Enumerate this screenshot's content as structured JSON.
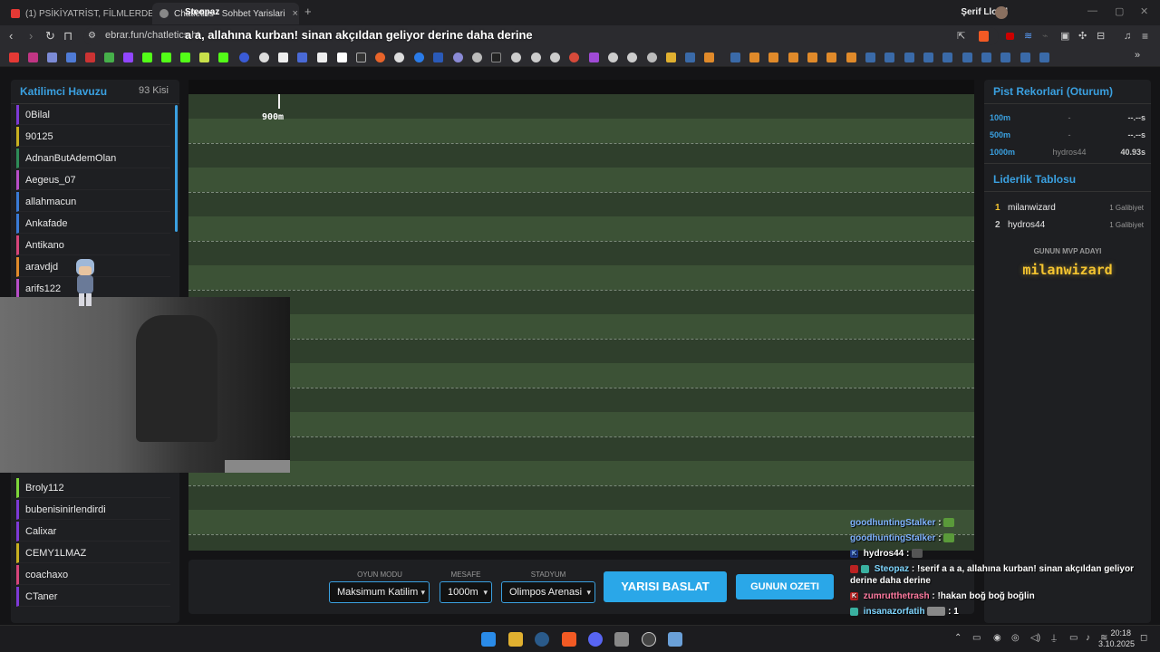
{
  "browser": {
    "tabs": [
      {
        "label": "(1) PSİKİYATRİST, FİLMLERDEKİ SERİ K",
        "favicon_color": "#e53935",
        "close": "×"
      },
      {
        "label": "Chatletics - Sohbet Yarislari",
        "favicon_color": "#aaaaaa",
        "close": "×"
      }
    ],
    "new_tab": "+",
    "profile_name": "Şerif Lloyd",
    "url": "ebrar.fun/chatletics.ht",
    "window_controls": [
      "—",
      "▢",
      "✕"
    ]
  },
  "stream_overlay": {
    "tab_text": "Steopaz",
    "title": "a a, allahına kurban! sinan akçıldan geliyor derine daha derine"
  },
  "participants": {
    "title": "Katilimci Havuzu",
    "count": "93 Kisi",
    "items": [
      {
        "name": "0Bilal",
        "color": "#7e3ad6"
      },
      {
        "name": "90125",
        "color": "#c8b020"
      },
      {
        "name": "AdnanButAdemOlan",
        "color": "#2e8b57"
      },
      {
        "name": "Aegeus_07",
        "color": "#b84ec8"
      },
      {
        "name": "allahmacun",
        "color": "#3a7bd5"
      },
      {
        "name": "Ankafade",
        "color": "#3a7bd5"
      },
      {
        "name": "Antikano",
        "color": "#d6457a"
      },
      {
        "name": "aravdjd",
        "color": "#e08a2a"
      },
      {
        "name": "arifs122",
        "color": "#b84ec8"
      },
      {
        "name": "Broly112",
        "color": "#7ed63a"
      },
      {
        "name": "bubenisinirlendirdi",
        "color": "#7e3ad6"
      },
      {
        "name": "Calixar",
        "color": "#7e3ad6"
      },
      {
        "name": "CEMY1LMAZ",
        "color": "#c8b020"
      },
      {
        "name": "coachaxo",
        "color": "#d6457a"
      },
      {
        "name": "CTaner",
        "color": "#7e3ad6"
      }
    ]
  },
  "track": {
    "distance_label": "900m"
  },
  "records": {
    "title": "Pist Rekorlari (Oturum)",
    "rows": [
      {
        "distance": "100m",
        "holder": "-",
        "time": "--.--s"
      },
      {
        "distance": "500m",
        "holder": "-",
        "time": "--.--s"
      },
      {
        "distance": "1000m",
        "holder": "hydros44",
        "time": "40.93s"
      }
    ]
  },
  "leaderboard": {
    "title": "Liderlik Tablosu",
    "rows": [
      {
        "rank": "1",
        "name": "milanwizard",
        "wins": "1 Galibiyet",
        "rank_color": "#f4c430"
      },
      {
        "rank": "2",
        "name": "hydros44",
        "wins": "1 Galibiyet",
        "rank_color": "#cccccc"
      }
    ],
    "mvp_label": "GUNUN MVP ADAYI",
    "mvp_name": "milanwizard"
  },
  "controls": {
    "mode_label": "OYUN MODU",
    "mode_value": "Maksimum Katilim",
    "distance_label": "MESAFE",
    "distance_value": "1000m",
    "stadium_label": "STADYUM",
    "stadium_value": "Olimpos Arenasi",
    "start_button": "YARISI BASLAT",
    "summary_button": "GUNUN OZETI"
  },
  "chat": [
    {
      "user": "goodhuntingStalker",
      "color": "#7fb3ff",
      "text": ":"
    },
    {
      "user": "goodhuntingStalker",
      "color": "#7fb3ff",
      "text": ":"
    },
    {
      "user": "hydros44",
      "color": "#ffffff",
      "text": ":"
    },
    {
      "user": "Steopaz",
      "color": "#7fd6ff",
      "text": ": !serif a a a, allahına kurban! sinan akçıldan geliyor derine daha derine"
    },
    {
      "user": "zumrutthetrash",
      "color": "#ff7aa0",
      "text": ": !hakan boğ boğ boğlin"
    },
    {
      "user": "insanazorfatih",
      "color": "#7fd6ff",
      "text": ": 1"
    }
  ],
  "taskbar": {
    "time": "20:18",
    "date": "3.10.2025"
  },
  "colors": {
    "accent": "#2aa7e8",
    "track_dark": "#2f3f2c",
    "track_light": "#3c5236",
    "mvp": "#f4c430"
  }
}
